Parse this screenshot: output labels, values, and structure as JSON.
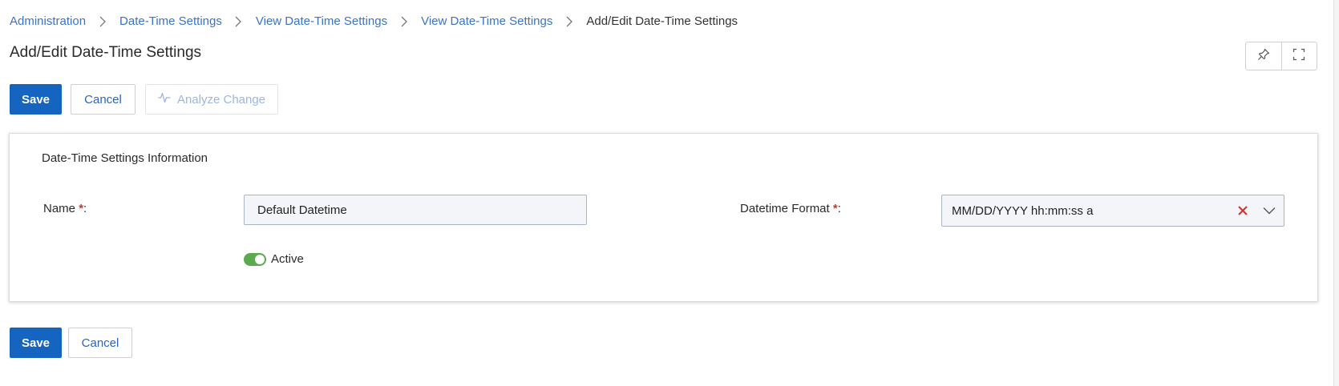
{
  "breadcrumb": {
    "items": [
      {
        "label": "Administration"
      },
      {
        "label": "Date-Time Settings"
      },
      {
        "label": "View Date-Time Settings"
      },
      {
        "label": "View Date-Time Settings"
      }
    ],
    "current": "Add/Edit Date-Time Settings"
  },
  "page": {
    "title": "Add/Edit Date-Time Settings",
    "tools": {
      "pin_icon": "pin-icon",
      "fullscreen_icon": "fullscreen-icon"
    }
  },
  "toolbar": {
    "save_label": "Save",
    "cancel_label": "Cancel",
    "analyze_label": "Analyze Change",
    "analyze_icon": "pulse-icon"
  },
  "form": {
    "section_title": "Date-Time Settings Information",
    "name_label": "Name",
    "name_value": "Default Datetime",
    "format_label": "Datetime Format",
    "format_value": "MM/DD/YYYY hh:mm:ss a",
    "required_mark": "*",
    "label_suffix": ":",
    "active_label": "Active",
    "active_on": true
  },
  "footer": {
    "save_label": "Save",
    "cancel_label": "Cancel"
  },
  "colors": {
    "primary": "#1565c0",
    "link": "#3b73c5",
    "required": "#d32f2f",
    "toggle_on": "#5aaa4e",
    "clear_icon": "#d32f2f"
  }
}
